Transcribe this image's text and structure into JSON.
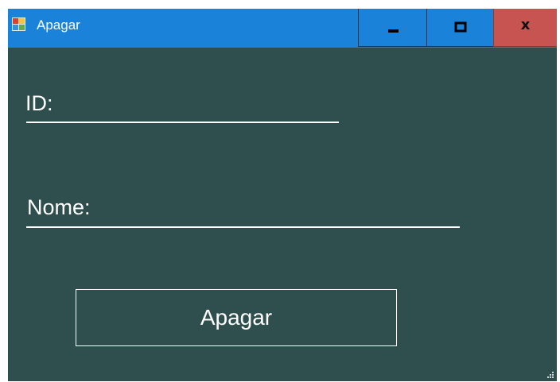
{
  "window": {
    "title": "Apagar",
    "background_color": "#2f4f4f",
    "titlebar_color": "#1a82d9",
    "close_color": "#c75450"
  },
  "titlebar_buttons": {
    "minimize": "minimize-icon",
    "maximize": "maximize-icon",
    "close": "x"
  },
  "form": {
    "id_label": "ID:",
    "id_value": "",
    "nome_label": "Nome:",
    "nome_value": "",
    "submit_label": "Apagar"
  }
}
